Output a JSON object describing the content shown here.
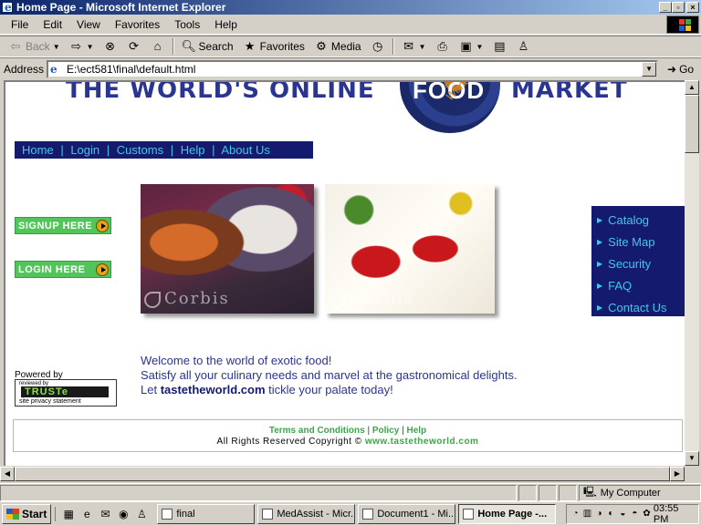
{
  "window": {
    "title": "Home Page - Microsoft Internet Explorer",
    "min": "_",
    "max": "▫",
    "close": "×"
  },
  "menu": [
    "File",
    "Edit",
    "View",
    "Favorites",
    "Tools",
    "Help"
  ],
  "toolbar": {
    "back": "Back",
    "search": "Search",
    "favorites": "Favorites",
    "media": "Media"
  },
  "address": {
    "label": "Address",
    "url": "E:\\ect581\\final\\default.html",
    "go": "Go"
  },
  "site": {
    "title_part1": "THE WORLD'S ONLINE",
    "title_overlay": "FOOD",
    "title_part2": "MARKET",
    "globe_text": "World",
    "nav": [
      "Home",
      "Login",
      "Customs",
      "Help",
      "About Us"
    ],
    "nav_sep": "|",
    "signup": "SIGNUP HERE",
    "login": "LOGIN HERE",
    "photo_watermark": "Corbis",
    "right_nav": [
      "Catalog",
      "Site Map",
      "Security",
      "FAQ",
      "Contact Us"
    ],
    "welcome_line1": "Welcome to the world of exotic food!",
    "welcome_line2": "Satisfy all your culinary needs and marvel at the gastronomical delights.",
    "welcome_line3_pre": "Let ",
    "welcome_brand": "tastetheworld.com",
    "welcome_line3_post": " tickle your palate today!",
    "powered_by": "Powered by",
    "truste_reviewed": "reviewed by",
    "truste_logo": "TRUSTe",
    "truste_sub": "site privacy statement",
    "footer_terms": "Terms and Conditions",
    "footer_policy": "Policy",
    "footer_help": "Help",
    "footer_sep": "|",
    "copyright": "All Rights Reserved Copyright ©",
    "copyright_url": "www.tastetheworld.com"
  },
  "status": {
    "text": "",
    "zone": "My Computer"
  },
  "taskbar": {
    "start": "Start",
    "tasks": [
      "final",
      "MedAssist - Micr...",
      "Document1 - Mi...",
      "Home Page -..."
    ],
    "clock": "03:55 PM"
  }
}
